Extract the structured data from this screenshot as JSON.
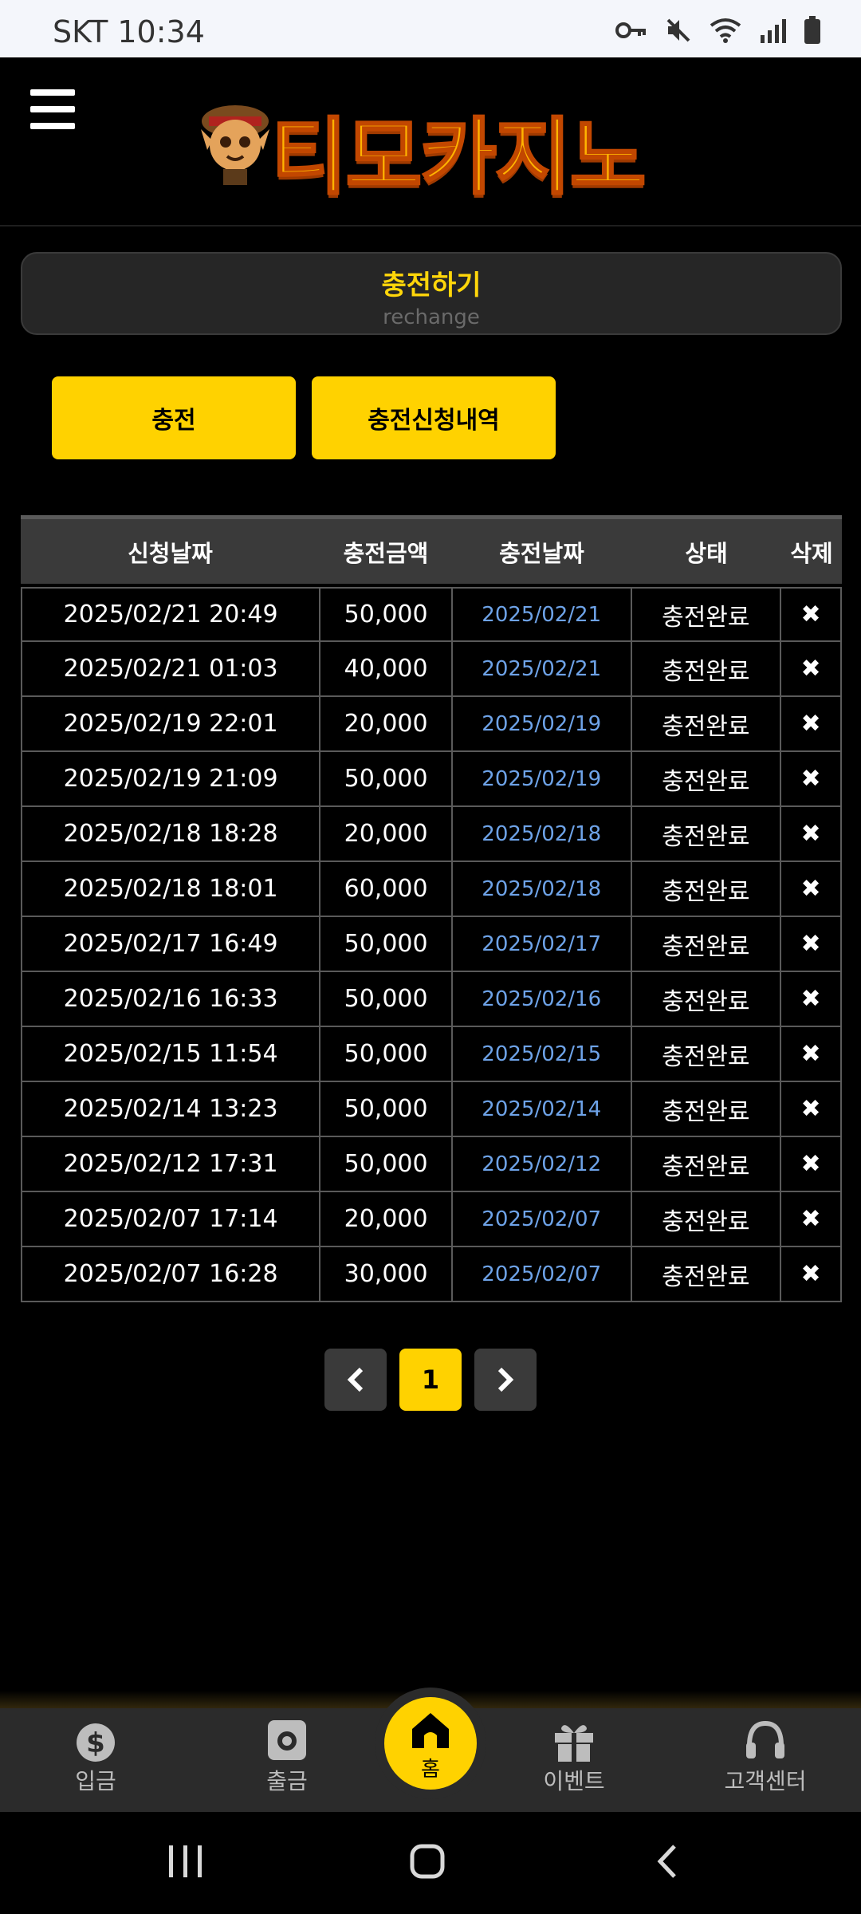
{
  "status_bar": {
    "carrier_time": "SKT 10:34",
    "icons": [
      "key-icon",
      "mute-icon",
      "wifi-icon",
      "signal-icon",
      "battery-icon"
    ]
  },
  "header": {
    "logo_text": "티모카지노"
  },
  "title": {
    "main": "충전하기",
    "sub": "rechange"
  },
  "buttons": {
    "charge": "충전",
    "history": "충전신청내역"
  },
  "table": {
    "headers": [
      "신청날짜",
      "충전금액",
      "충전날짜",
      "상태",
      "삭제"
    ],
    "rows": [
      {
        "request_date": "2025/02/21 20:49",
        "amount": "50,000",
        "charge_date": "2025/02/21",
        "status": "충전완료"
      },
      {
        "request_date": "2025/02/21 01:03",
        "amount": "40,000",
        "charge_date": "2025/02/21",
        "status": "충전완료"
      },
      {
        "request_date": "2025/02/19 22:01",
        "amount": "20,000",
        "charge_date": "2025/02/19",
        "status": "충전완료"
      },
      {
        "request_date": "2025/02/19 21:09",
        "amount": "50,000",
        "charge_date": "2025/02/19",
        "status": "충전완료"
      },
      {
        "request_date": "2025/02/18 18:28",
        "amount": "20,000",
        "charge_date": "2025/02/18",
        "status": "충전완료"
      },
      {
        "request_date": "2025/02/18 18:01",
        "amount": "60,000",
        "charge_date": "2025/02/18",
        "status": "충전완료"
      },
      {
        "request_date": "2025/02/17 16:49",
        "amount": "50,000",
        "charge_date": "2025/02/17",
        "status": "충전완료"
      },
      {
        "request_date": "2025/02/16 16:33",
        "amount": "50,000",
        "charge_date": "2025/02/16",
        "status": "충전완료"
      },
      {
        "request_date": "2025/02/15 11:54",
        "amount": "50,000",
        "charge_date": "2025/02/15",
        "status": "충전완료"
      },
      {
        "request_date": "2025/02/14 13:23",
        "amount": "50,000",
        "charge_date": "2025/02/14",
        "status": "충전완료"
      },
      {
        "request_date": "2025/02/12 17:31",
        "amount": "50,000",
        "charge_date": "2025/02/12",
        "status": "충전완료"
      },
      {
        "request_date": "2025/02/07 17:14",
        "amount": "20,000",
        "charge_date": "2025/02/07",
        "status": "충전완료"
      },
      {
        "request_date": "2025/02/07 16:28",
        "amount": "30,000",
        "charge_date": "2025/02/07",
        "status": "충전완료"
      }
    ],
    "delete_glyph": "✖"
  },
  "pagination": {
    "current": "1"
  },
  "bottom_nav": {
    "deposit": "입금",
    "withdraw": "출금",
    "home": "홈",
    "event": "이벤트",
    "support": "고객센터"
  },
  "colors": {
    "accent": "#ffd200",
    "link": "#6ea3e8",
    "panel": "#262626"
  }
}
